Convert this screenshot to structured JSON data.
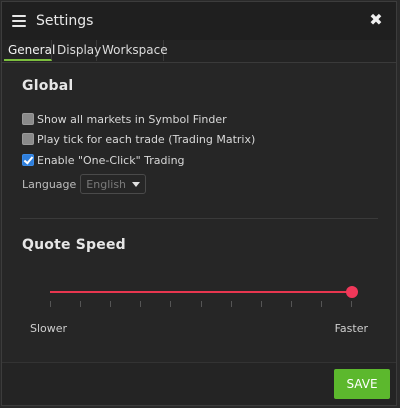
{
  "header": {
    "title": "Settings",
    "menu_icon": "hamburger-icon",
    "close_icon": "close-icon",
    "close_glyph": "✖"
  },
  "tabs": [
    {
      "label": "General",
      "active": true
    },
    {
      "label": "Display",
      "active": false
    },
    {
      "label": "Workspace",
      "active": false
    }
  ],
  "global": {
    "title": "Global",
    "options": [
      {
        "label": "Show all markets in Symbol Finder",
        "checked": false
      },
      {
        "label": "Play tick for each trade (Trading Matrix)",
        "checked": false
      },
      {
        "label": "Enable \"One-Click\" Trading",
        "checked": true
      }
    ],
    "language": {
      "label": "Language",
      "value": "English"
    }
  },
  "quote_speed": {
    "title": "Quote Speed",
    "min_label": "Slower",
    "max_label": "Faster",
    "value_fraction": 1.0,
    "tick_count": 11
  },
  "footer": {
    "save_label": "SAVE"
  },
  "colors": {
    "accent_green": "#5cb82d",
    "slider_red": "#e8364f",
    "checkbox_blue": "#2f7fdc"
  }
}
